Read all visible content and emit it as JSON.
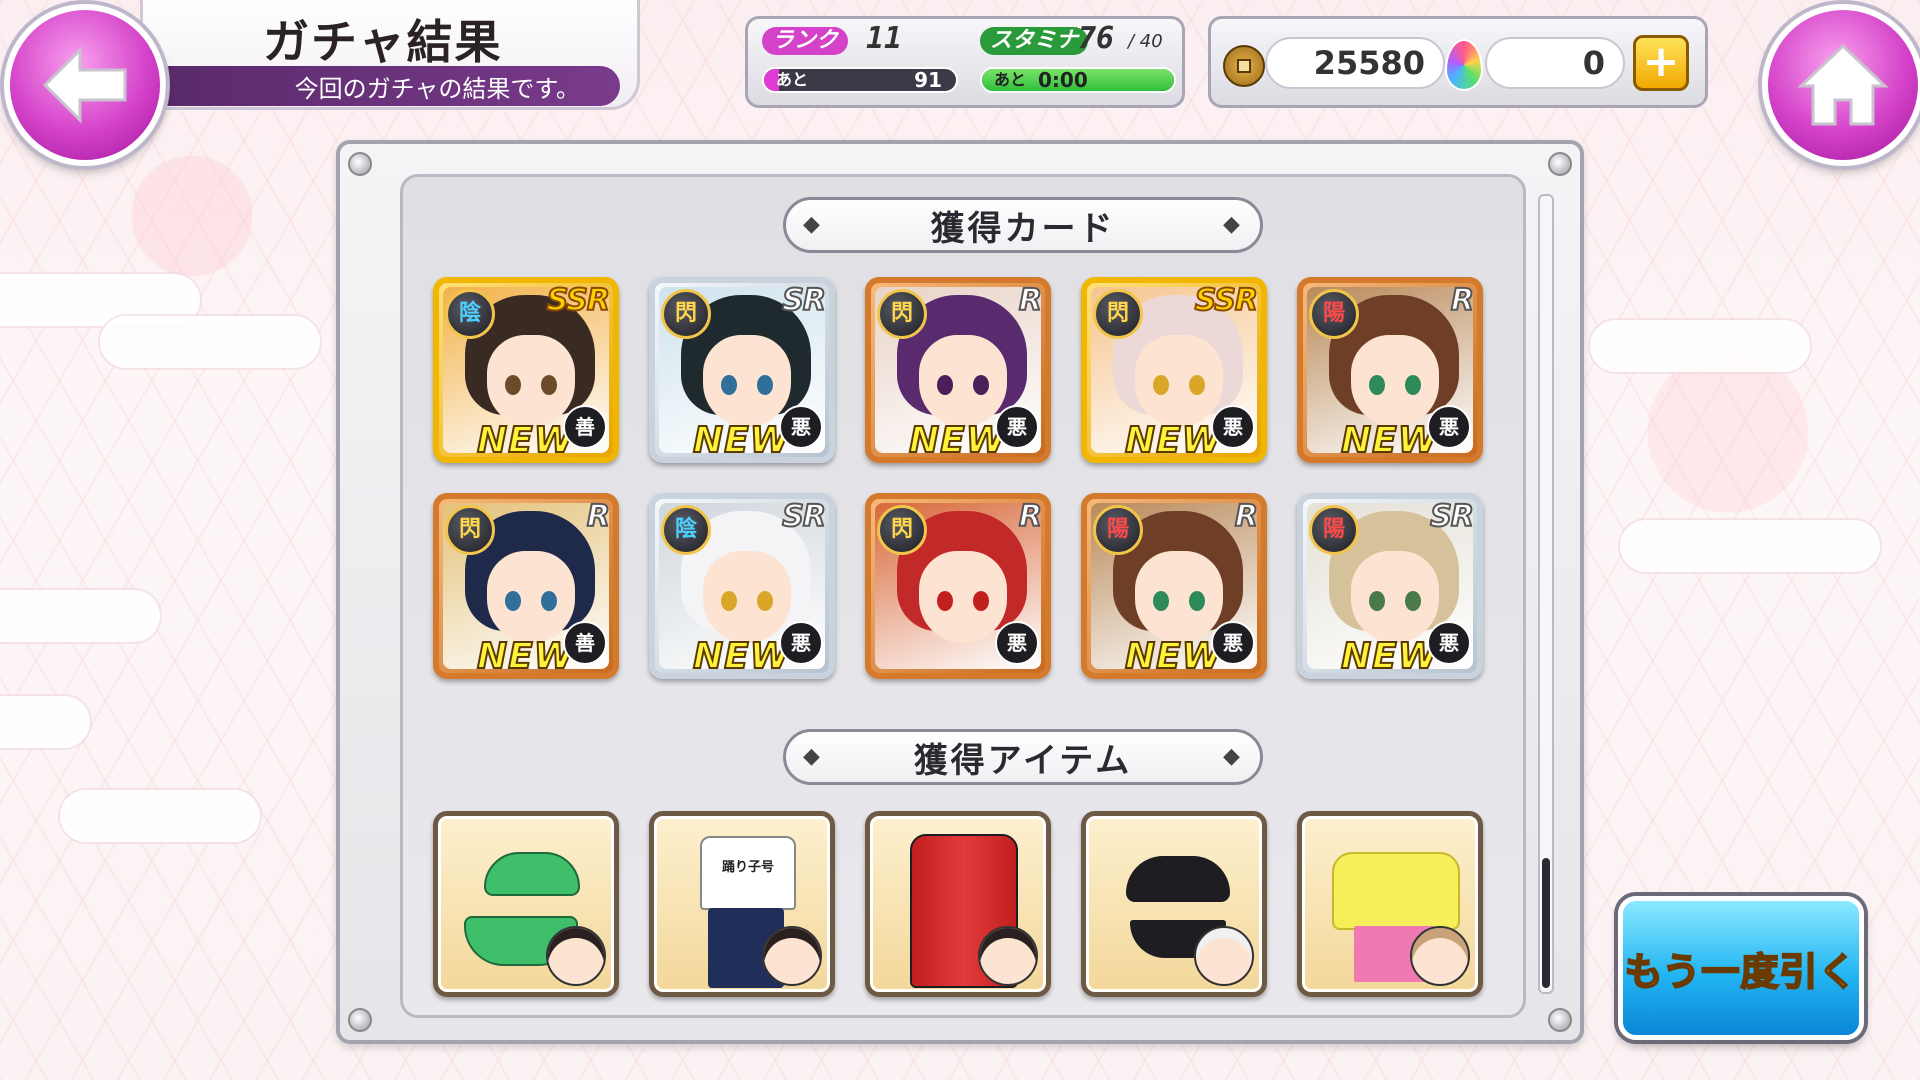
{
  "header": {
    "title": "ガチャ結果",
    "subtitle": "今回のガチャの結果です。"
  },
  "status": {
    "rank_label": "ランク",
    "rank_value": "11",
    "rank_remaining_label": "あと",
    "rank_remaining_value": "91",
    "stamina_label": "スタミナ",
    "stamina_current": "76",
    "stamina_max": "40",
    "stamina_remaining_label": "あと",
    "stamina_timer": "0:00",
    "stamina_fill": 1.0,
    "rank_fill": 0.08
  },
  "currency": {
    "coins": "25580",
    "gems": "0",
    "add_symbol": "+"
  },
  "sections": {
    "cards_title": "獲得カード",
    "items_title": "獲得アイテム"
  },
  "cards": [
    {
      "rarity": "SSR",
      "attr": "陰",
      "attr_type": "yin",
      "align": "善",
      "new_label": "NEW",
      "hair": "#3a2a24",
      "eye": "#6b4b2a",
      "bg": "#f2b24a"
    },
    {
      "rarity": "SR",
      "attr": "閃",
      "attr_type": "sen",
      "align": "悪",
      "new_label": "NEW",
      "hair": "#1f2a2e",
      "eye": "#2f6f9a",
      "bg": "#cfe3ee"
    },
    {
      "rarity": "R",
      "attr": "閃",
      "attr_type": "sen",
      "align": "悪",
      "new_label": "NEW",
      "hair": "#5a2a6e",
      "eye": "#4a1f5a",
      "bg": "#e8d3c7"
    },
    {
      "rarity": "SSR",
      "attr": "閃",
      "attr_type": "sen",
      "align": "悪",
      "new_label": "NEW",
      "hair": "#ecd8d6",
      "eye": "#d9a62a",
      "bg": "#f6c58f"
    },
    {
      "rarity": "R",
      "attr": "陽",
      "attr_type": "yang",
      "align": "悪",
      "new_label": "NEW",
      "hair": "#6e3f26",
      "eye": "#2f8a5a",
      "bg": "#b98a5a"
    },
    {
      "rarity": "R",
      "attr": "閃",
      "attr_type": "sen",
      "align": "善",
      "new_label": "NEW",
      "hair": "#1f2a4a",
      "eye": "#2f6f9a",
      "bg": "#e3c27a"
    },
    {
      "rarity": "SR",
      "attr": "陰",
      "attr_type": "yin",
      "align": "悪",
      "new_label": "NEW",
      "hair": "#f4f4f6",
      "eye": "#d9a62a",
      "bg": "#cfd6dc"
    },
    {
      "rarity": "R",
      "attr": "閃",
      "attr_type": "sen",
      "align": "悪",
      "new_label": "",
      "hair": "#c22a2a",
      "eye": "#c21f1f",
      "bg": "#d8683a"
    },
    {
      "rarity": "R",
      "attr": "陽",
      "attr_type": "yang",
      "align": "悪",
      "new_label": "NEW",
      "hair": "#6e3f26",
      "eye": "#2f8a5a",
      "bg": "#b98a5a"
    },
    {
      "rarity": "SR",
      "attr": "陽",
      "attr_type": "yang",
      "align": "悪",
      "new_label": "NEW",
      "hair": "#d6c29a",
      "eye": "#4a7a4a",
      "bg": "#e4e0d6"
    }
  ],
  "items": [
    {
      "name": "green-bikini",
      "color": "#3fbf6a",
      "accent": "#ffffff",
      "chibi_hair": "#2a2020"
    },
    {
      "name": "tshirt-outfit",
      "color": "#ffffff",
      "accent": "#1f2f5a",
      "text": "踊り子号",
      "chibi_hair": "#2a2020"
    },
    {
      "name": "red-tracksuit",
      "color": "#c21f1f",
      "accent": "#1e1e22",
      "chibi_hair": "#2a2020"
    },
    {
      "name": "black-bikini",
      "color": "#1e1e22",
      "accent": "#1e1e22",
      "chibi_hair": "#f0f0f0"
    },
    {
      "name": "yellow-sweater",
      "color": "#f6ef5a",
      "accent": "#ef7ab2",
      "chibi_hair": "#c9a27a"
    }
  ],
  "retry_button": "もう一度引く",
  "colors": {
    "accent_magenta": "#d442c9",
    "retry_blue": "#22b5f3",
    "coin_gold": "#f1b600"
  }
}
